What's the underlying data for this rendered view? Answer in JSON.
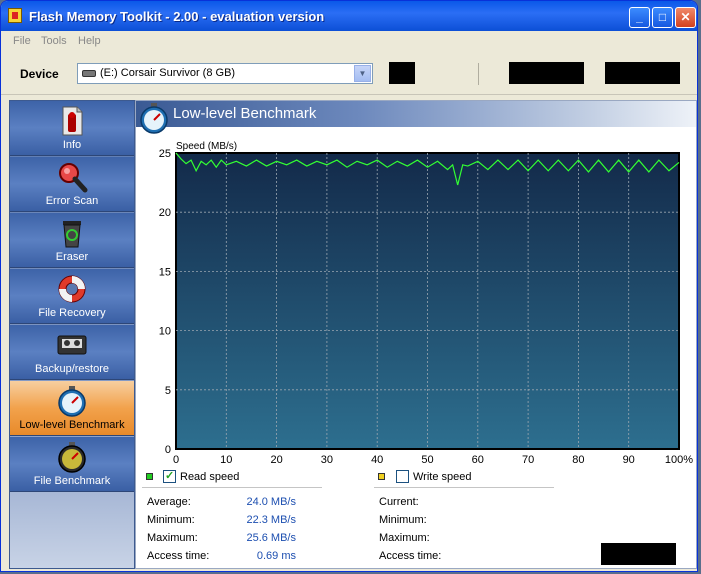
{
  "window": {
    "title": "Flash Memory Toolkit - 2.00 - evaluation version"
  },
  "titlebar": {
    "minimize": "_",
    "maximize": "□",
    "close": "✕"
  },
  "menu": {
    "items": [
      "File",
      "Tools",
      "Help"
    ]
  },
  "device": {
    "label": "Device",
    "selected": "(E:) Corsair Survivor (8 GB)"
  },
  "sidebar": {
    "items": [
      {
        "label": "Info",
        "icon": "info-icon"
      },
      {
        "label": "Error Scan",
        "icon": "magnifier-icon"
      },
      {
        "label": "Eraser",
        "icon": "recycle-bin-icon"
      },
      {
        "label": "File Recovery",
        "icon": "lifebuoy-icon"
      },
      {
        "label": "Backup/restore",
        "icon": "tape-icon"
      },
      {
        "label": "Low-level Benchmark",
        "icon": "stopwatch-icon",
        "active": true
      },
      {
        "label": "File Benchmark",
        "icon": "stopwatch-dark-icon"
      }
    ]
  },
  "panel": {
    "title": "Low-level Benchmark"
  },
  "chart_data": {
    "type": "line",
    "ylabel": "Speed (MB/s)",
    "ylim": [
      0,
      25
    ],
    "xlim": [
      0,
      100
    ],
    "yticks": [
      "25",
      "20",
      "15",
      "10",
      "5",
      "0"
    ],
    "xticks": [
      "0",
      "10",
      "20",
      "30",
      "40",
      "50",
      "60",
      "70",
      "80",
      "90",
      "100%"
    ],
    "grid": true,
    "background": "#1f4f6e",
    "series": [
      {
        "color": "#33ff33",
        "x": [
          0,
          1,
          2,
          3,
          4,
          5,
          6,
          7,
          8,
          9,
          10,
          12,
          14,
          16,
          18,
          20,
          22,
          24,
          26,
          28,
          30,
          32,
          34,
          36,
          38,
          40,
          42,
          44,
          46,
          48,
          50,
          52,
          54,
          55,
          56,
          57,
          58,
          60,
          62,
          64,
          66,
          68,
          70,
          72,
          74,
          76,
          78,
          80,
          82,
          84,
          86,
          88,
          90,
          92,
          94,
          96,
          98,
          100
        ],
        "y": [
          25.5,
          24.5,
          24.1,
          24.4,
          23.5,
          24.3,
          24.0,
          24.4,
          23.8,
          24.4,
          24.0,
          24.3,
          23.9,
          24.4,
          23.9,
          24.3,
          24.0,
          24.4,
          23.9,
          24.3,
          24.0,
          24.4,
          23.8,
          24.3,
          24.0,
          24.4,
          23.8,
          24.3,
          23.9,
          24.4,
          23.8,
          24.3,
          23.6,
          24.0,
          22.3,
          24.0,
          23.9,
          24.3,
          23.6,
          24.4,
          23.6,
          24.4,
          23.5,
          24.4,
          23.5,
          24.4,
          23.5,
          24.4,
          23.4,
          24.4,
          23.4,
          24.4,
          23.4,
          24.4,
          23.4,
          24.4,
          23.5,
          24.2
        ]
      }
    ]
  },
  "read": {
    "legend_color": "#22cc22",
    "label": "Read speed",
    "checked": true,
    "average_label": "Average:",
    "average": "24.0 MB/s",
    "minimum_label": "Minimum:",
    "minimum": "22.3 MB/s",
    "maximum_label": "Maximum:",
    "maximum": "25.6 MB/s",
    "access_label": "Access time:",
    "access": "0.69 ms"
  },
  "write": {
    "legend_color": "#f0d020",
    "label": "Write speed",
    "checked": false,
    "current_label": "Current:",
    "minimum_label": "Minimum:",
    "maximum_label": "Maximum:",
    "access_label": "Access time:"
  }
}
